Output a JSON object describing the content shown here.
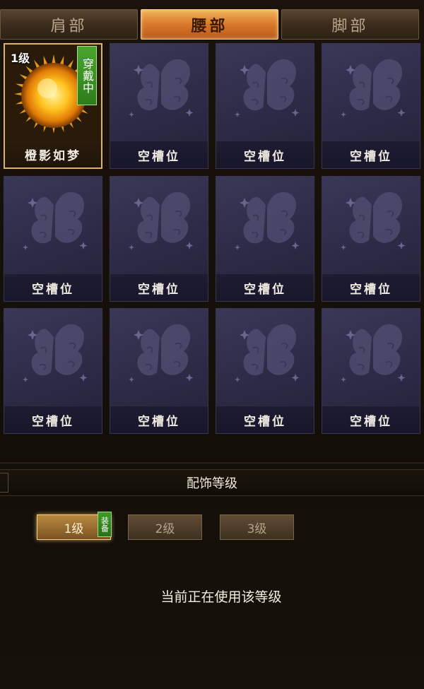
{
  "tabs": [
    {
      "label": "肩部",
      "active": false
    },
    {
      "label": "腰部",
      "active": true
    },
    {
      "label": "脚部",
      "active": false
    }
  ],
  "slots": [
    {
      "label": "橙影如梦",
      "equipped": true,
      "level_badge": "1级",
      "wear_tag": "穿戴中",
      "icon": "golden-sun-icon"
    },
    {
      "label": "空槽位",
      "icon": "butterfly-placeholder-icon"
    },
    {
      "label": "空槽位",
      "icon": "butterfly-placeholder-icon"
    },
    {
      "label": "空槽位",
      "icon": "butterfly-placeholder-icon"
    },
    {
      "label": "空槽位",
      "icon": "butterfly-placeholder-icon"
    },
    {
      "label": "空槽位",
      "icon": "butterfly-placeholder-icon"
    },
    {
      "label": "空槽位",
      "icon": "butterfly-placeholder-icon"
    },
    {
      "label": "空槽位",
      "icon": "butterfly-placeholder-icon"
    },
    {
      "label": "空槽位",
      "icon": "butterfly-placeholder-icon"
    },
    {
      "label": "空槽位",
      "icon": "butterfly-placeholder-icon"
    },
    {
      "label": "空槽位",
      "icon": "butterfly-placeholder-icon"
    },
    {
      "label": "空槽位",
      "icon": "butterfly-placeholder-icon"
    }
  ],
  "section": {
    "title": "配饰等级"
  },
  "levels": [
    {
      "label": "1级",
      "active": true
    },
    {
      "label": "2级",
      "active": false
    },
    {
      "label": "3级",
      "active": false
    }
  ],
  "equip_flag": "装备",
  "status_text": "当前正在使用该等级",
  "colors": {
    "accent": "#d9782a",
    "wear_green": "#3f9a2a",
    "slot_bg": "#2c2a45"
  }
}
